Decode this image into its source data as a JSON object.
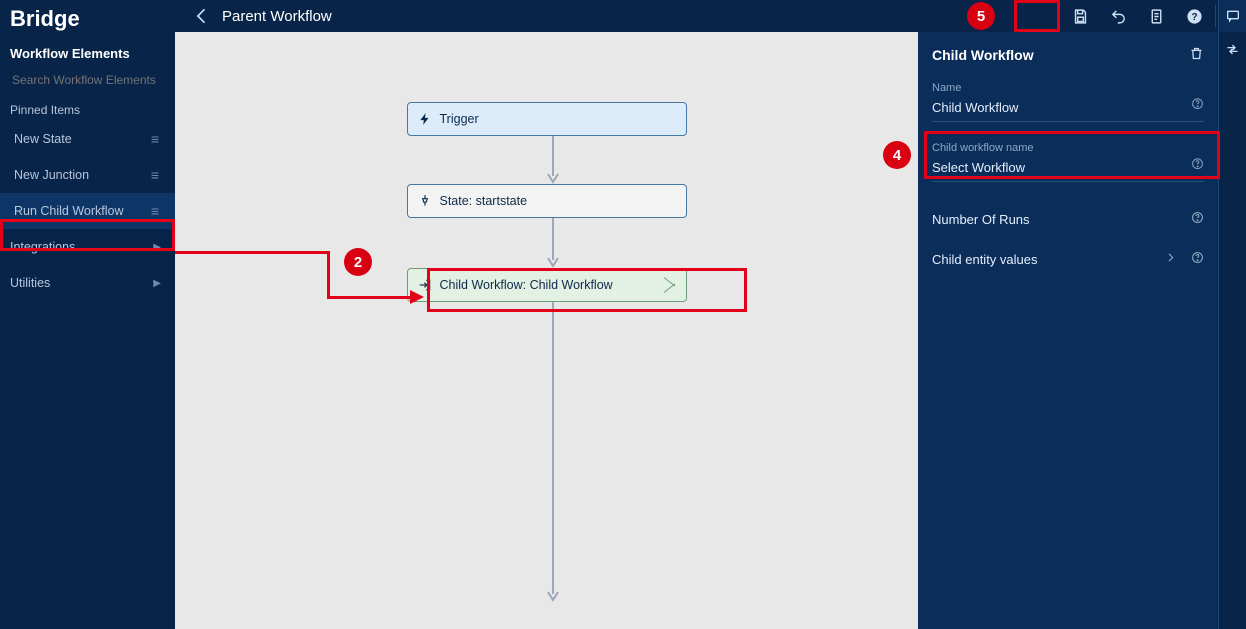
{
  "app": {
    "name": "Bridge"
  },
  "header": {
    "title": "Parent Workflow"
  },
  "sidebar": {
    "title": "Workflow Elements",
    "search_placeholder": "Search Workflow Elements",
    "pinned_label": "Pinned Items",
    "pinned": [
      {
        "label": "New State"
      },
      {
        "label": "New Junction"
      },
      {
        "label": "Run Child Workflow"
      }
    ],
    "categories": [
      {
        "label": "Integrations"
      },
      {
        "label": "Utilities"
      }
    ]
  },
  "canvas": {
    "trigger_label": "Trigger",
    "state_label": "State: startstate",
    "child_label": "Child Workflow: Child Workflow"
  },
  "right_panel": {
    "title": "Child Workflow",
    "name_label": "Name",
    "name_value": "Child Workflow",
    "child_name_label": "Child workflow name",
    "child_name_value": "Select Workflow",
    "runs_label": "Number Of Runs",
    "entity_label": "Child entity values"
  },
  "annotations": {
    "n2": "2",
    "n4": "4",
    "n5": "5"
  }
}
